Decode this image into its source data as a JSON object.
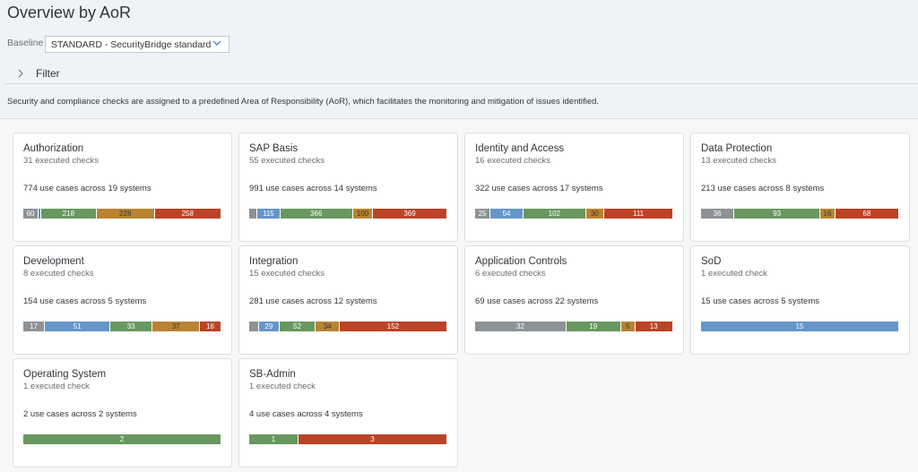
{
  "header": {
    "title": "Overview by AoR",
    "baseline_label": "Baseline",
    "baseline_value": "STANDARD - SecurityBridge standard",
    "filter_label": "Filter",
    "description": "Security and compliance checks are assigned to a predefined Area of Responsibility (AoR), which facilitates the monitoring and mitigation of issues identified."
  },
  "colors": {
    "grey": "#8d9296",
    "blue": "#6496c8",
    "green": "#68985f",
    "orange": "#b98331",
    "red": "#bb4326"
  },
  "cards": [
    {
      "title": "Authorization",
      "checks": "31 executed checks",
      "usecases": "774 use cases across 19 systems",
      "segments": [
        {
          "color": "grey",
          "value": 60,
          "label": "60"
        },
        {
          "color": "blue",
          "value": 10,
          "label": ""
        },
        {
          "color": "green",
          "value": 218,
          "label": "218"
        },
        {
          "color": "orange",
          "value": 228,
          "label": "228"
        },
        {
          "color": "red",
          "value": 258,
          "label": "258"
        }
      ]
    },
    {
      "title": "SAP Basis",
      "checks": "55 executed checks",
      "usecases": "991 use cases across 14 systems",
      "segments": [
        {
          "color": "grey",
          "value": 41,
          "label": ""
        },
        {
          "color": "blue",
          "value": 115,
          "label": "115"
        },
        {
          "color": "green",
          "value": 366,
          "label": "366"
        },
        {
          "color": "orange",
          "value": 100,
          "label": "100"
        },
        {
          "color": "red",
          "value": 369,
          "label": "369"
        }
      ]
    },
    {
      "title": "Identity and Access",
      "checks": "16 executed checks",
      "usecases": "322 use cases across 17 systems",
      "segments": [
        {
          "color": "grey",
          "value": 25,
          "label": "25"
        },
        {
          "color": "blue",
          "value": 54,
          "label": "54"
        },
        {
          "color": "green",
          "value": 102,
          "label": "102"
        },
        {
          "color": "orange",
          "value": 30,
          "label": "30"
        },
        {
          "color": "red",
          "value": 111,
          "label": "111"
        }
      ]
    },
    {
      "title": "Data Protection",
      "checks": "13 executed checks",
      "usecases": "213 use cases across 8 systems",
      "segments": [
        {
          "color": "grey",
          "value": 36,
          "label": "36"
        },
        {
          "color": "green",
          "value": 93,
          "label": "93"
        },
        {
          "color": "orange",
          "value": 16,
          "label": "16"
        },
        {
          "color": "red",
          "value": 68,
          "label": "68"
        }
      ]
    },
    {
      "title": "Development",
      "checks": "8 executed checks",
      "usecases": "154 use cases across 5 systems",
      "segments": [
        {
          "color": "grey",
          "value": 17,
          "label": "17"
        },
        {
          "color": "blue",
          "value": 51,
          "label": "51"
        },
        {
          "color": "green",
          "value": 33,
          "label": "33"
        },
        {
          "color": "orange",
          "value": 37,
          "label": "37"
        },
        {
          "color": "red",
          "value": 16,
          "label": "16"
        }
      ]
    },
    {
      "title": "Integration",
      "checks": "15 executed checks",
      "usecases": "281 use cases across 12 systems",
      "segments": [
        {
          "color": "grey",
          "value": 14,
          "label": ""
        },
        {
          "color": "blue",
          "value": 29,
          "label": "29"
        },
        {
          "color": "green",
          "value": 52,
          "label": "52"
        },
        {
          "color": "orange",
          "value": 34,
          "label": "34"
        },
        {
          "color": "red",
          "value": 152,
          "label": "152"
        }
      ]
    },
    {
      "title": "Application Controls",
      "checks": "6 executed checks",
      "usecases": "69 use cases across 22 systems",
      "segments": [
        {
          "color": "grey",
          "value": 32,
          "label": "32"
        },
        {
          "color": "green",
          "value": 19,
          "label": "19"
        },
        {
          "color": "orange",
          "value": 5,
          "label": "5"
        },
        {
          "color": "red",
          "value": 13,
          "label": "13"
        }
      ]
    },
    {
      "title": "SoD",
      "checks": "1 executed check",
      "usecases": "15 use cases across 5 systems",
      "segments": [
        {
          "color": "blue",
          "value": 15,
          "label": "15"
        }
      ]
    },
    {
      "title": "Operating System",
      "checks": "1 executed check",
      "usecases": "2 use cases across 2 systems",
      "segments": [
        {
          "color": "green",
          "value": 2,
          "label": "2"
        }
      ]
    },
    {
      "title": "SB-Admin",
      "checks": "1 executed check",
      "usecases": "4 use cases across 4 systems",
      "segments": [
        {
          "color": "green",
          "value": 1,
          "label": "1"
        },
        {
          "color": "red",
          "value": 3,
          "label": "3"
        }
      ]
    }
  ]
}
